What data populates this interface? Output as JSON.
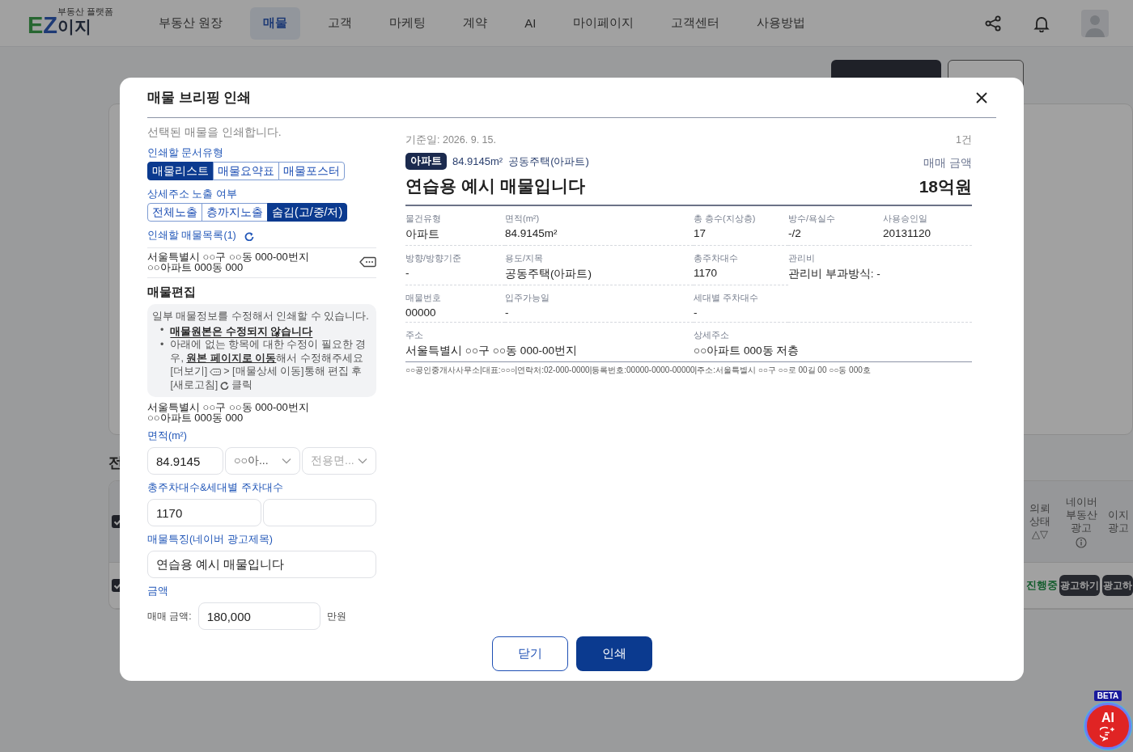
{
  "nav": {
    "logo": {
      "mark_e": "E",
      "mark_z": "Z",
      "name": "이지",
      "tagline": "부동산 플랫폼"
    },
    "items": [
      {
        "label": "부동산 원장",
        "selected": false
      },
      {
        "label": "매물",
        "selected": true
      },
      {
        "label": "고객",
        "selected": false
      },
      {
        "label": "마케팅",
        "selected": false
      },
      {
        "label": "계약",
        "selected": false
      },
      {
        "label": "AI",
        "selected": false
      },
      {
        "label": "마이페이지",
        "selected": false
      },
      {
        "label": "고객센터",
        "selected": false
      },
      {
        "label": "사용방법",
        "selected": false
      }
    ]
  },
  "background": {
    "buttons": [
      {
        "kind": "dark"
      },
      {
        "kind": "outline"
      }
    ],
    "section_heading": "전",
    "table": {
      "header_checked": true,
      "columns": [
        {
          "label": "의뢰 상태 △▽",
          "info": false
        },
        {
          "label": "네이버 부동산 광고",
          "info": true
        },
        {
          "label": "이지 광고",
          "info": false
        }
      ],
      "rows": [
        {
          "checked": true,
          "status": "진행중",
          "actions": [
            "광고하기",
            "광고하"
          ]
        }
      ]
    }
  },
  "modal": {
    "title": "매물 브리핑 인쇄",
    "intro": "선택된 매물을 인쇄합니다.",
    "doc_type": {
      "label": "인쇄할 문서유형",
      "options": [
        {
          "label": "매물리스트",
          "selected": true
        },
        {
          "label": "매물요약표",
          "selected": false
        },
        {
          "label": "매물포스터",
          "selected": false
        }
      ]
    },
    "address_mode": {
      "label": "상세주소 노출 여부",
      "options": [
        {
          "label": "전체노출",
          "selected": false
        },
        {
          "label": "층까지노출",
          "selected": false
        },
        {
          "label": "숨김(고/중/저)",
          "selected": true
        }
      ]
    },
    "print_list": {
      "label": "인쇄할 매물목록(1)",
      "items": [
        {
          "address": "서울특별시 ○○구 ○○동 000-00번지",
          "detail": "○○아파트 000동 000"
        }
      ]
    },
    "edit": {
      "heading": "매물편집",
      "notice": {
        "intro": "일부 매물정보를 수정해서 인쇄할 수 있습니다.",
        "marker": "•",
        "bullets": [
          {
            "emphasized": true,
            "parts": [
              {
                "kind": "text",
                "text": "매물원본은 수정되지 않습니다"
              }
            ]
          },
          {
            "emphasized": false,
            "parts": [
              {
                "kind": "text",
                "text": "아래에 없는 항목에 대한 수정이 필요한 경우, **원본 페이지로 이동**해서 수정해주세요 [더보기]"
              },
              {
                "kind": "tag_icon"
              },
              {
                "kind": "text",
                "text": "> [매물상세 이동]통해 편집 후 [새로고침]"
              },
              {
                "kind": "refresh_icon"
              },
              {
                "kind": "text",
                "text": "클릭"
              }
            ]
          }
        ]
      },
      "address": "서울특별시 ○○구 ○○동 000-00번지",
      "detail": "○○아파트 000동 000",
      "area": {
        "label": "면적(m²)",
        "value": "84.9145",
        "complex": "○○아...",
        "area_type_placeholder": "전용면..."
      },
      "parking": {
        "label": "총주차대수&세대별 주차대수",
        "total": "1170"
      },
      "headline": {
        "label": "매물특징(네이버 광고제목)",
        "value": "연습용 예시 매물입니다"
      },
      "price": {
        "label": "금액",
        "field_label": "매매 금액:",
        "value": "180,000",
        "unit": "만원"
      }
    },
    "preview": {
      "date": "기준일: 2026. 9. 15.",
      "count": "1건",
      "badge": "아파트",
      "area": "84.9145m²",
      "usage": "공동주택(아파트)",
      "title": "연습용 예시 매물입니다",
      "price_label": "매매 금액",
      "price": "18억원",
      "fields": [
        {
          "label": "물건유형",
          "value": "아파트"
        },
        {
          "label": "면적(m²)",
          "value": "84.9145m²"
        },
        {
          "label": "총 층수(지상층)",
          "value": "17"
        },
        {
          "label": "방수/욕실수",
          "value": "-/2"
        },
        {
          "label": "사용승인일",
          "value": "20131120"
        },
        {
          "label": "방향/방향기준",
          "value": "-"
        },
        {
          "label": "용도/지목",
          "value": "공동주택(아파트)"
        },
        {
          "label": "총주차대수",
          "value": "1170"
        },
        {
          "label": "관리비",
          "value": "관리비 부과방식: -"
        },
        {
          "label": "매물번호",
          "value": "00000"
        },
        {
          "label": "입주가능일",
          "value": "-"
        },
        {
          "label": "세대별 주차대수",
          "value": "-"
        },
        {
          "label": "주소",
          "value": "서울특별시 ○○구 ○○동 000-00번지"
        },
        {
          "label": "상세주소",
          "value": "○○아파트 000동 저층"
        }
      ],
      "footer": "○○공인중개사사무소|대표:○○○|연락처:02-000-0000|등록번호:00000-0000-00000|주소:서울특별시 ○○구 ○○로 00길 00 ○○동 000호"
    },
    "buttons": [
      {
        "label": "닫기",
        "kind": "secondary"
      },
      {
        "label": "인쇄",
        "kind": "primary"
      }
    ]
  },
  "ai_button": {
    "badge": "BETA",
    "label": "AI"
  }
}
